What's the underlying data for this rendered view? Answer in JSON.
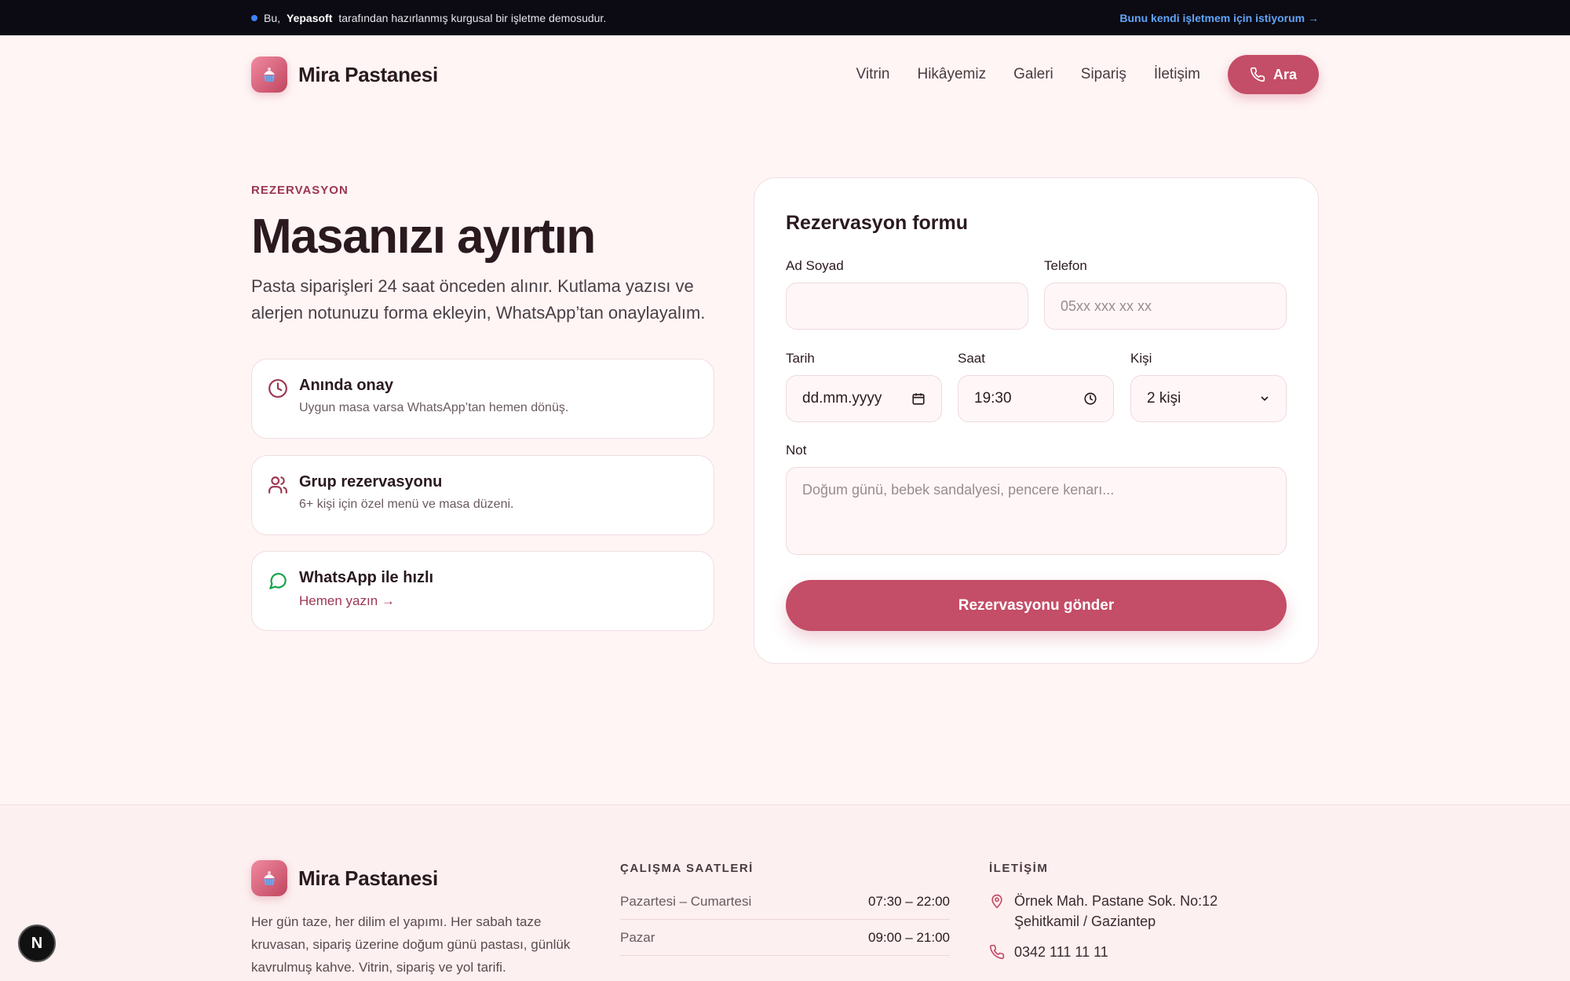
{
  "banner": {
    "prefix": "Bu,",
    "brand": "Yepasoft",
    "suffix": "tarafından hazırlanmış kurgusal bir işletme demosudur.",
    "link": "Bunu kendi işletmem için istiyorum →"
  },
  "header": {
    "brand": "Mira Pastanesi",
    "nav": [
      "Vitrin",
      "Hikâyemiz",
      "Galeri",
      "Sipariş",
      "İletişim"
    ],
    "call_label": "Ara"
  },
  "hero": {
    "eyebrow": "REZERVASYON",
    "title": "Masanızı ayırtın",
    "lead": "Pasta siparişleri 24 saat önceden alınır. Kutlama yazısı ve alerjen notunuzu forma ekleyin, WhatsApp’tan onaylayalım."
  },
  "cards": [
    {
      "title": "Anında onay",
      "desc": "Uygun masa varsa WhatsApp’tan hemen dönüş.",
      "icon": "clock-icon"
    },
    {
      "title": "Grup rezervasyonu",
      "desc": "6+ kişi için özel menü ve masa düzeni.",
      "icon": "users-icon"
    },
    {
      "title": "WhatsApp ile hızlı",
      "link": "Hemen yazın →",
      "icon": "chat-icon"
    }
  ],
  "form": {
    "title": "Rezervasyon formu",
    "name_label": "Ad Soyad",
    "name_value": "",
    "phone_label": "Telefon",
    "phone_placeholder": "05xx xxx xx xx",
    "date_label": "Tarih",
    "date_placeholder": "dd.mm.yyyy",
    "time_label": "Saat",
    "time_value": "19:30",
    "people_label": "Kişi",
    "people_value": "2 kişi",
    "note_label": "Not",
    "note_placeholder": "Doğum günü, bebek sandalyesi, pencere kenarı...",
    "submit": "Rezervasyonu gönder"
  },
  "footer": {
    "brand": "Mira Pastanesi",
    "desc": "Her gün taze, her dilim el yapımı. Her sabah taze kruvasan, sipariş üzerine doğum günü pastası, günlük kavrulmuş kahve. Vitrin, sipariş ve yol tarifi.",
    "hours_heading": "ÇALIŞMA SAATLERİ",
    "hours": [
      {
        "day": "Pazartesi – Cumartesi",
        "time": "07:30 – 22:00"
      },
      {
        "day": "Pazar",
        "time": "09:00 – 21:00"
      }
    ],
    "contact_heading": "İLETİŞİM",
    "address": "Örnek Mah. Pastane Sok. No:12 Şehitkamil / Gaziantep",
    "phone": "0342 111 11 11"
  },
  "badge": "N",
  "colors": {
    "accent": "#c44d67",
    "accent_dark": "#9c3651",
    "background": "#fff5f5",
    "banner": "#0c0a12",
    "banner_link": "#60a5fa"
  }
}
